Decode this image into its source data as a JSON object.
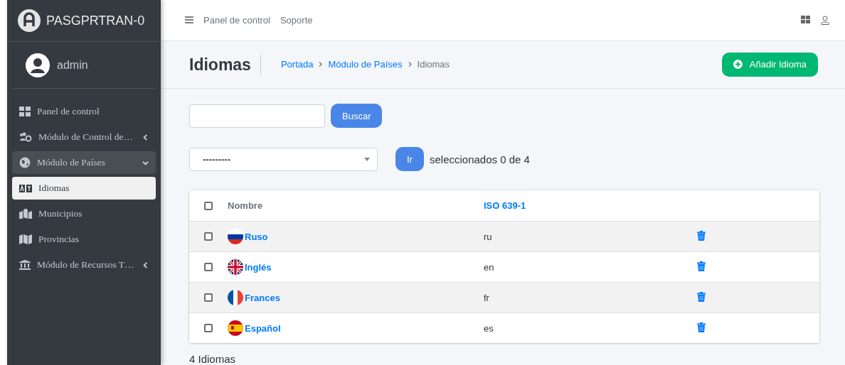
{
  "sidebar": {
    "brand": "PASGPRTRAN-0",
    "user": "admin",
    "items": [
      {
        "label": "Panel de control",
        "selected": false
      },
      {
        "label": "Módulo de Control de…",
        "expanded": false,
        "selected": false
      },
      {
        "label": "Módulo de Países",
        "expanded": true,
        "selected": true,
        "children": [
          {
            "label": "Idiomas",
            "selected": true
          },
          {
            "label": "Municipios",
            "selected": false
          },
          {
            "label": "Provincias",
            "selected": false
          }
        ]
      },
      {
        "label": "Módulo de Recursos T…",
        "expanded": false,
        "selected": false
      }
    ]
  },
  "topbar": {
    "links": [
      "Panel de control",
      "Soporte"
    ]
  },
  "header": {
    "title": "Idiomas",
    "breadcrumb": [
      {
        "label": "Portada",
        "link": true
      },
      {
        "label": "Módulo de Países",
        "link": true
      },
      {
        "label": "Idiomas",
        "link": false
      }
    ],
    "add_button": "Añadir Idioma"
  },
  "search": {
    "button": "Buscar"
  },
  "actions": {
    "value": "---------",
    "go_button": "Ir",
    "selection_count": "seleccionados 0 de 4"
  },
  "table": {
    "all_checked": false,
    "columns": [
      {
        "label": "Nombre",
        "sortable": false
      },
      {
        "label": "ISO 639-1",
        "sortable": true
      }
    ],
    "rows": [
      {
        "name": "Ruso",
        "code": "ru",
        "checked": false
      },
      {
        "name": "Inglés",
        "code": "en",
        "checked": false
      },
      {
        "name": "Frances",
        "code": "fr",
        "checked": false
      },
      {
        "name": "Español",
        "code": "es",
        "checked": false
      }
    ]
  },
  "footer": "4 Idiomas"
}
